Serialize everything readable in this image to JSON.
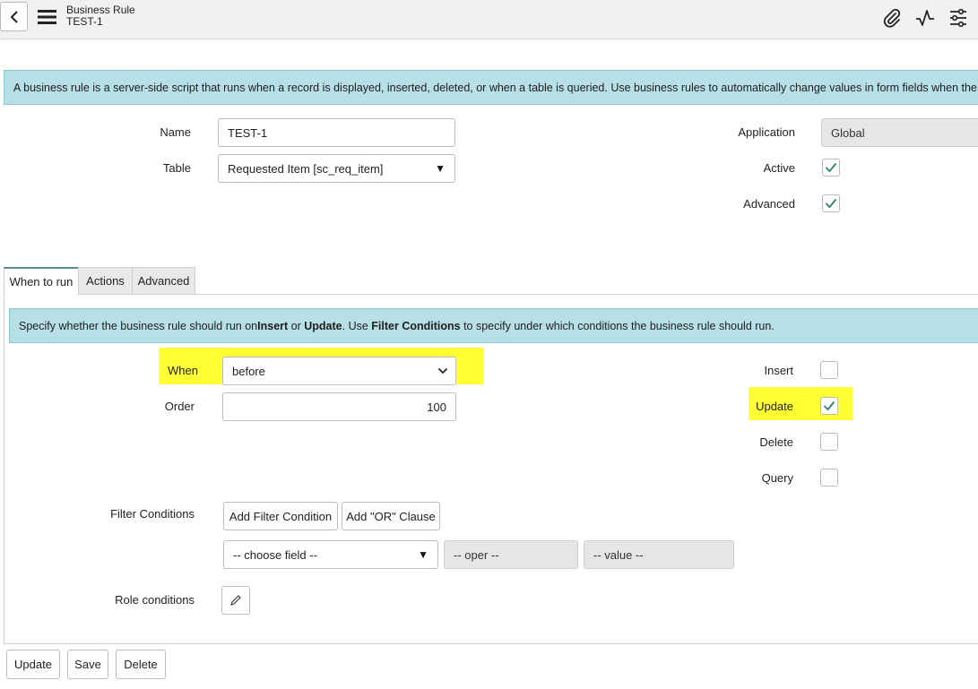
{
  "header": {
    "record_type": "Business Rule",
    "record_name": "TEST-1",
    "icons": [
      "back-icon",
      "hamburger-menu-icon",
      "paperclip-icon",
      "activity-icon",
      "settings-sliders-icon"
    ]
  },
  "intro": {
    "text": "A business rule is a server-side script that runs when a record is displayed, inserted, deleted, or when a table is queried. Use business rules to automatically change values in form fields when the specifi"
  },
  "form": {
    "name_label": "Name",
    "name_value": "TEST-1",
    "table_label": "Table",
    "table_value": "Requested Item [sc_req_item]",
    "application_label": "Application",
    "application_value": "Global",
    "active_label": "Active",
    "active_checked": true,
    "advanced_label": "Advanced",
    "advanced_checked": true
  },
  "tabs": [
    {
      "label": "When to run",
      "active": true
    },
    {
      "label": "Actions",
      "active": false
    },
    {
      "label": "Advanced",
      "active": false
    }
  ],
  "when_to_run": {
    "info_part1": "Specify whether the business rule should run on ",
    "info_insert": "Insert",
    "info_or": " or ",
    "info_update": "Update",
    "info_part2": ". Use ",
    "info_filter": "Filter Conditions",
    "info_part3": " to specify under which conditions the business rule should run.",
    "when_label": "When",
    "when_value": "before",
    "order_label": "Order",
    "order_value": "100",
    "insert_label": "Insert",
    "insert_checked": false,
    "update_label": "Update",
    "update_checked": true,
    "delete_label": "Delete",
    "delete_checked": false,
    "query_label": "Query",
    "query_checked": false,
    "filter_label": "Filter Conditions",
    "add_filter_label": "Add Filter Condition",
    "add_or_label": "Add \"OR\" Clause",
    "choose_field": "-- choose field --",
    "oper": "-- oper --",
    "value": "-- value --",
    "role_label": "Role conditions"
  },
  "footer": {
    "update_label": "Update",
    "save_label": "Save",
    "delete_label": "Delete"
  },
  "colors": {
    "info_bg": "#b7dfe6",
    "highlight": "#ffff33",
    "check": "#2e7d6e"
  }
}
